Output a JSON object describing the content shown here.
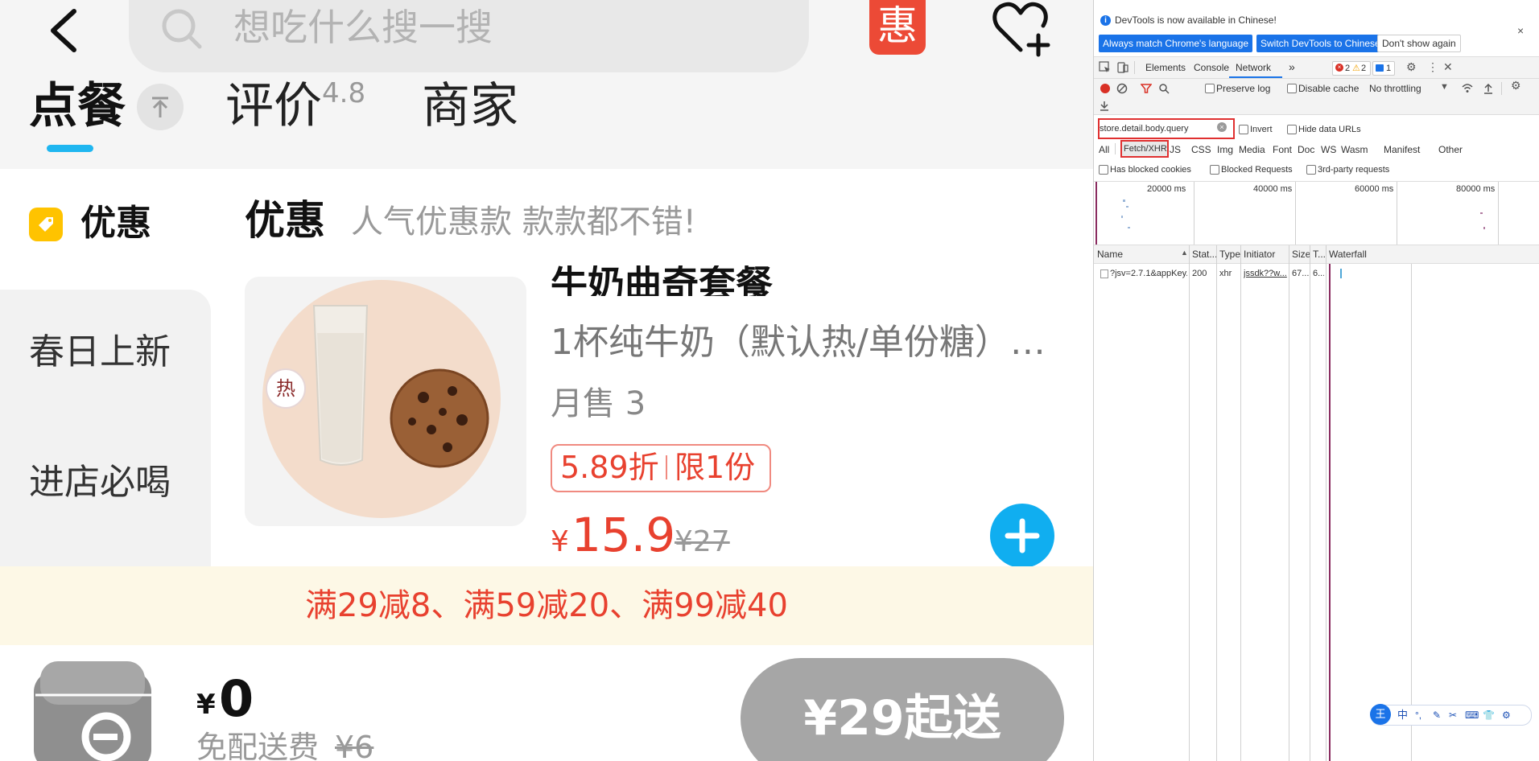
{
  "app": {
    "search_placeholder": "想吃什么搜一搜",
    "hui_badge": "惠",
    "tabs": [
      {
        "label": "点餐"
      },
      {
        "label": "评价",
        "rating": "4.8"
      },
      {
        "label": "商家"
      }
    ],
    "sidebar": {
      "items": [
        {
          "label": "优惠"
        },
        {
          "label": "春日上新"
        },
        {
          "label": "进店必喝"
        }
      ]
    },
    "section": {
      "title": "优惠",
      "subtitle": "人气优惠款 款款都不错!"
    },
    "product": {
      "name": "牛奶曲奇套餐",
      "hot_badge": "热",
      "description": "1杯纯牛奶（默认热/单份糖）…",
      "sales": "月售 3",
      "discount": "5.89折",
      "limit": "限1份",
      "price_currency": "¥",
      "price": "15.9",
      "original_price": "¥27"
    },
    "promo": "满29减8、满59减20、满99减40",
    "cart": {
      "currency": "¥",
      "total": "0",
      "delivery_label": "免配送费",
      "delivery_original": "¥6",
      "min_order_label": "¥29起送"
    },
    "colors": {
      "accent_blue": "#1fb6f0",
      "price_red": "#e8412f",
      "promo_bg": "#fdf8e6"
    }
  },
  "devtools": {
    "notice": "DevTools is now available in Chinese!",
    "btn_match": "Always match Chrome's language",
    "btn_switch": "Switch DevTools to Chinese",
    "btn_dismiss": "Don't show again",
    "tabs": [
      "Elements",
      "Console",
      "Network"
    ],
    "errors": "2",
    "warnings": "2",
    "messages": "1",
    "preserve_log": "Preserve log",
    "disable_cache": "Disable cache",
    "throttling": "No throttling",
    "filter_value": "store.detail.body.query",
    "invert": "Invert",
    "hide_data_urls": "Hide data URLs",
    "filter_types": [
      "All",
      "Fetch/XHR",
      "JS",
      "CSS",
      "Img",
      "Media",
      "Font",
      "Doc",
      "WS",
      "Wasm",
      "Manifest",
      "Other"
    ],
    "has_blocked_cookies": "Has blocked cookies",
    "blocked_requests": "Blocked Requests",
    "third_party": "3rd-party requests",
    "timeline_ticks": [
      "20000 ms",
      "40000 ms",
      "60000 ms",
      "80000 ms"
    ],
    "columns": [
      "Name",
      "Stat...",
      "Type",
      "Initiator",
      "Size",
      "T...",
      "Waterfall"
    ],
    "rows": [
      {
        "name": "?jsv=2.7.1&appKey...",
        "status": "200",
        "type": "xhr",
        "initiator": "jssdk??w...",
        "size": "67....",
        "time": "6..."
      }
    ],
    "ime": [
      "中",
      "°,",
      "✎",
      "✂",
      "⌨",
      "👕",
      "⚙"
    ],
    "ime_logo": "王"
  }
}
